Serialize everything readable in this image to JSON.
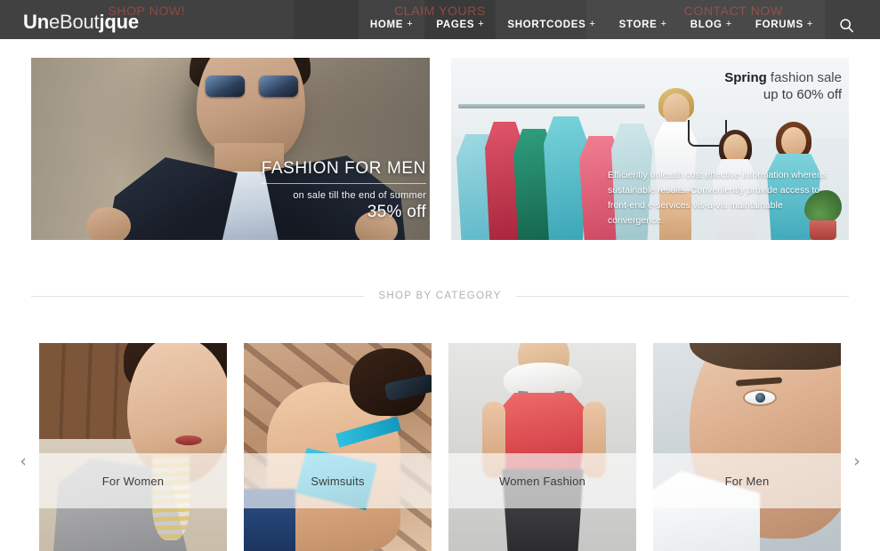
{
  "cta_bar": {
    "items": [
      {
        "label": "SHOP NOW!"
      },
      {
        "label": "CLAIM YOURS"
      },
      {
        "label": "CONTACT NOW"
      }
    ]
  },
  "header": {
    "logo": {
      "part1": "Un",
      "part2": "eBout",
      "part3": "jque"
    },
    "nav": [
      {
        "label": "HOME",
        "plus": "+"
      },
      {
        "label": "PAGES",
        "plus": "+"
      },
      {
        "label": "SHORTCODES",
        "plus": "+"
      },
      {
        "label": "STORE",
        "plus": "+"
      },
      {
        "label": "BLOG",
        "plus": "+"
      },
      {
        "label": "FORUMS",
        "plus": "+"
      }
    ],
    "search_icon": "search-icon"
  },
  "heroes": {
    "left": {
      "title": "FASHION FOR MEN",
      "subtitle": "on sale till the end of summer",
      "offer": "35% off"
    },
    "right": {
      "headline_strong": "Spring",
      "headline_rest": " fashion sale",
      "headline_line2": "up to 60% off",
      "paragraph": "Efficiently unleash cost effective information whereas sustainable results. Conveniently provide access to front-end e-services vis-a-vis maintainable convergence."
    }
  },
  "section": {
    "title": "SHOP BY CATEGORY"
  },
  "carousel": {
    "prev_icon": "‹",
    "next_icon": "›",
    "cards": [
      {
        "label": "For Women"
      },
      {
        "label": "Swimsuits"
      },
      {
        "label": "Women Fashion"
      },
      {
        "label": "For Men"
      }
    ]
  },
  "colors": {
    "header_bg": "#3a3a3a",
    "cta_text": "#8f4a43",
    "nav_text": "#ffffff",
    "divider": "#e2e2e2",
    "section_title": "#b2b2b2",
    "card_label": "#3c3c3c"
  }
}
